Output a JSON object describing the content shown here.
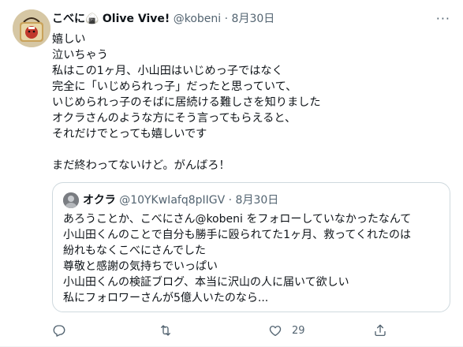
{
  "tweet": {
    "author_name": "こべに",
    "author_emoji": "🍙",
    "author_suffix": "Olive Vive!",
    "handle": "@kobeni",
    "separator": "·",
    "date": "8月30日",
    "more": "···",
    "lines": [
      "嬉しい",
      "泣いちゃう",
      "私はこの1ヶ月、小山田はいじめっ子ではなく",
      "完全に「いじめられっ子」だったと思っていて、",
      "いじめられっ子のそばに居続ける難しさを知りました",
      "オクラさんのような方にそう言ってもらえると、",
      "それだけでとっても嬉しいです",
      "まだ終わってないけど。がんばろ！"
    ]
  },
  "quote": {
    "author_name": "オクラ",
    "handle": "@10YKwIafq8pIIGV",
    "separator": "·",
    "date": "8月30日",
    "lines": [
      "あろうことか、こべにさん@kobeni をフォローしていなかったなんて",
      "小山田くんのことで自分も勝手に殴られてた1ヶ月、救ってくれたのは",
      "紛れもなくこべにさんでした",
      "尊敬と感謝の気持ちでいっぱい",
      "小山田くんの検証ブログ、本当に沢山の人に届いて欲しい",
      "私にフォロワーさんが5億人いたのなら..."
    ]
  },
  "actions": {
    "reply_icon": "reply-icon",
    "retweet_icon": "retweet-icon",
    "like_icon": "like-icon",
    "like_count": "29",
    "share_icon": "share-icon"
  }
}
